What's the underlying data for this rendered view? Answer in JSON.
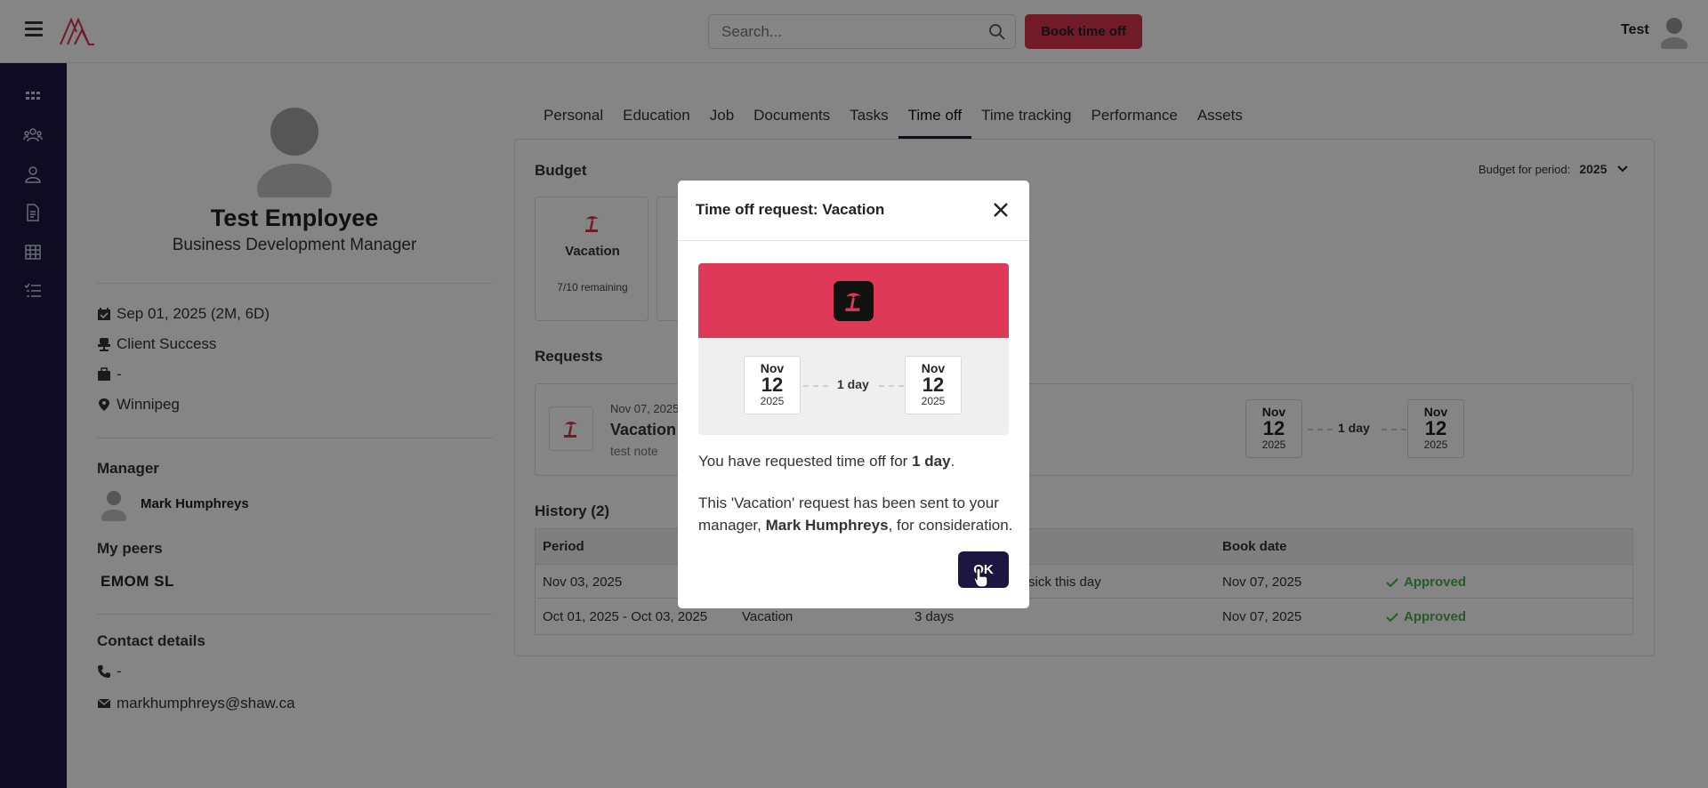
{
  "topbar": {
    "search_placeholder": "Search...",
    "book_button": "Book time off",
    "user_name": "Test"
  },
  "sidebar": {
    "items": [
      {
        "icon": "apps-grid-icon"
      },
      {
        "icon": "team-icon"
      },
      {
        "icon": "person-icon"
      },
      {
        "icon": "document-icon"
      },
      {
        "icon": "calendar-icon"
      },
      {
        "icon": "checklist-icon"
      }
    ]
  },
  "profile": {
    "name": "Test Employee",
    "title": "Business Development Manager",
    "start_date": "Sep 01, 2025 (2M, 6D)",
    "department": "Client Success",
    "division": "-",
    "location": "Winnipeg",
    "manager_label": "Manager",
    "manager_name": "Mark Humphreys",
    "peers_label": "My peers",
    "peers": "EMOM SL",
    "contact_label": "Contact details",
    "phone": "-",
    "email": "markhumphreys@shaw.ca"
  },
  "tabs": [
    "Personal",
    "Education",
    "Job",
    "Documents",
    "Tasks",
    "Time off",
    "Time tracking",
    "Performance",
    "Assets"
  ],
  "active_tab": "Time off",
  "budget": {
    "label": "Budget",
    "period_label": "Budget for period:",
    "period_value": "2025",
    "card_name": "Vacation",
    "card_remaining": "7/10 remaining"
  },
  "requests": {
    "label": "Requests",
    "date": "Nov 07, 2025",
    "type": "Vacation",
    "note": "test note",
    "from": {
      "month": "Nov",
      "day": "12",
      "year": "2025"
    },
    "to": {
      "month": "Nov",
      "day": "12",
      "year": "2025"
    },
    "duration": "1 day"
  },
  "history": {
    "label": "History (2)",
    "headers": {
      "period": "Period",
      "book_date": "Book date"
    },
    "rows": [
      {
        "period": "Nov 03, 2025",
        "type": "",
        "duration": "",
        "note": "sick this day",
        "book_date": "Nov 07, 2025",
        "status": "Approved"
      },
      {
        "period": "Oct 01, 2025 - Oct 03, 2025",
        "type": "Vacation",
        "duration": "3 days",
        "note": "",
        "book_date": "Nov 07, 2025",
        "status": "Approved"
      }
    ]
  },
  "modal": {
    "title": "Time off request: Vacation",
    "from": {
      "month": "Nov",
      "day": "12",
      "year": "2025"
    },
    "to": {
      "month": "Nov",
      "day": "12",
      "year": "2025"
    },
    "duration": "1 day",
    "text1_prefix": "You have requested time off for ",
    "text1_bold": "1 day",
    "text1_suffix": ".",
    "text2_prefix": "This 'Vacation' request has been sent to your manager, ",
    "text2_bold": "Mark Humphreys",
    "text2_suffix": ", for consideration.",
    "ok_button": "OK"
  },
  "colors": {
    "sidebar": "#1c1642",
    "accent_red": "#d9354f",
    "approved_green": "#4caf50"
  }
}
